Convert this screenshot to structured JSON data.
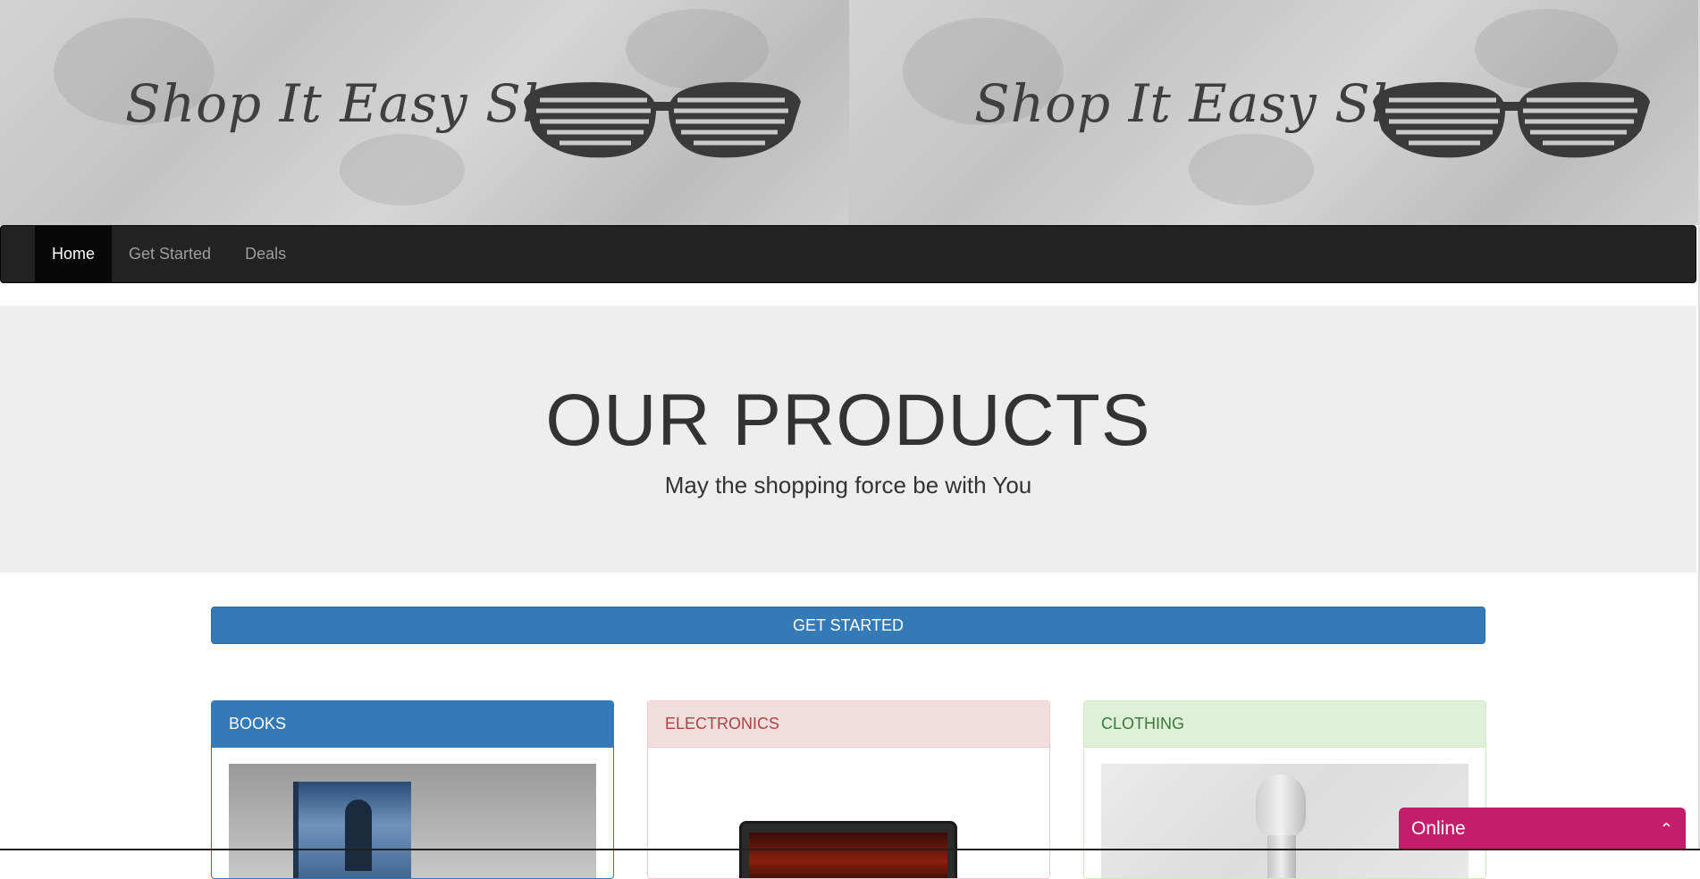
{
  "banner": {
    "logo_text": "Shop It Easy Shop",
    "logo_alt": "Shop It Easy Shop"
  },
  "nav": {
    "items": [
      {
        "label": "Home",
        "active": true
      },
      {
        "label": "Get Started",
        "active": false
      },
      {
        "label": "Deals",
        "active": false
      }
    ]
  },
  "hero": {
    "title": "OUR PRODUCTS",
    "subtitle": "May the shopping force be with You"
  },
  "cta": {
    "label": "GET STARTED",
    "color": "#337ab7"
  },
  "panels": [
    {
      "title": "BOOKS",
      "style": "primary",
      "color": "#337ab7"
    },
    {
      "title": "ELECTRONICS",
      "style": "danger",
      "color": "#f2dede"
    },
    {
      "title": "CLOTHING",
      "style": "success",
      "color": "#dff0d8"
    }
  ],
  "chat": {
    "label": "Online",
    "icon": "chevron-up-icon",
    "color": "#c41d6b"
  }
}
